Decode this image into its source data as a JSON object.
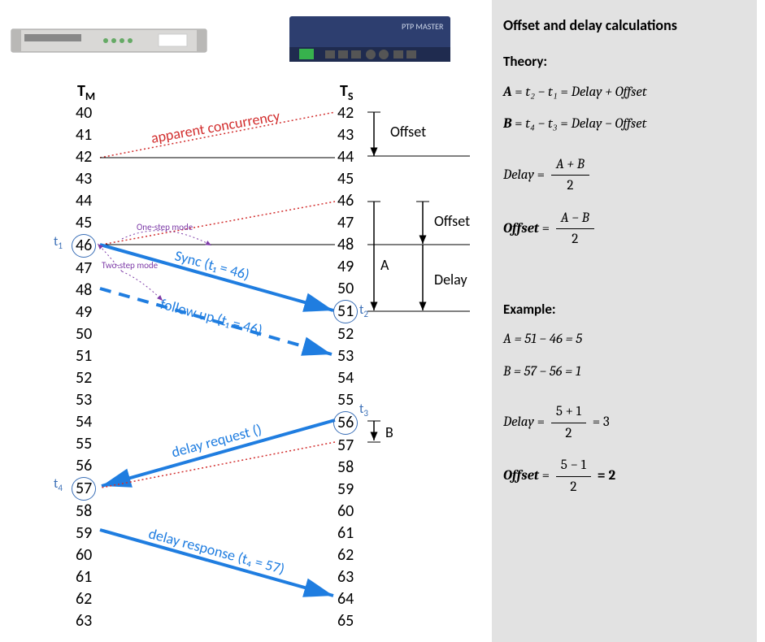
{
  "columns": {
    "master": {
      "label": "T",
      "sub": "M",
      "values": [
        "40",
        "41",
        "42",
        "43",
        "44",
        "45",
        "46",
        "47",
        "48",
        "49",
        "50",
        "51",
        "52",
        "53",
        "54",
        "55",
        "56",
        "57",
        "58",
        "59",
        "60",
        "61",
        "62",
        "63"
      ],
      "circled": [
        "46",
        "57"
      ]
    },
    "slave": {
      "label": "T",
      "sub": "S",
      "values": [
        "42",
        "43",
        "44",
        "45",
        "46",
        "47",
        "48",
        "49",
        "50",
        "51",
        "52",
        "53",
        "54",
        "55",
        "56",
        "57",
        "58",
        "59",
        "60",
        "61",
        "62",
        "63",
        "64",
        "65"
      ],
      "circled": [
        "51",
        "56"
      ]
    }
  },
  "ts_markers": {
    "t1": {
      "label": "t",
      "sub": "1",
      "value": "46",
      "side": "master"
    },
    "t2": {
      "label": "t",
      "sub": "2",
      "value": "51",
      "side": "slave"
    },
    "t3": {
      "label": "t",
      "sub": "3",
      "value": "56",
      "side": "slave"
    },
    "t4": {
      "label": "t",
      "sub": "4",
      "value": "57",
      "side": "master"
    }
  },
  "annotations": {
    "apparent_concurrency": "apparent concurrency",
    "one_step": "One-step mode",
    "two_step": "Two-step mode",
    "sync_label": "Sync (t₁ = 46)",
    "follow_up_label": "follow up (t₁ = 46)",
    "delay_request_label": "delay request ()",
    "delay_response_label": "delay response (t₄ = 57)",
    "offset_label": "Offset",
    "delay_label": "Delay",
    "A_label": "A",
    "B_label": "B"
  },
  "calc_panel": {
    "title": "Offset and delay calculations",
    "theory_label": "Theory:",
    "example_label": "Example:",
    "A_def_lhs": "A",
    "A_def_rhs1": "t₂ − t₁",
    "A_def_rhs2": "Delay + Offset",
    "B_def_lhs": "B",
    "B_def_rhs1": "t₄ − t₃",
    "B_def_rhs2": "Delay − Offset",
    "delay_name": "Delay",
    "offset_name": "Offset",
    "frac_AB_plus_num": "A + B",
    "frac_AB_minus_num": "A − B",
    "frac_den_2": "2",
    "A_ex": "A = 51 − 46 = 5",
    "B_ex": "B = 57 − 56 = 1",
    "delay_ex_num": "5 + 1",
    "delay_ex_res": "= 3",
    "offset_ex_num": "5 − 1",
    "offset_ex_res": "= 2"
  },
  "colors": {
    "arrow_blue": "#1f7de0",
    "red": "#d22e2e",
    "purple": "#7e3ca8",
    "circle_blue": "#3a6fb7"
  }
}
